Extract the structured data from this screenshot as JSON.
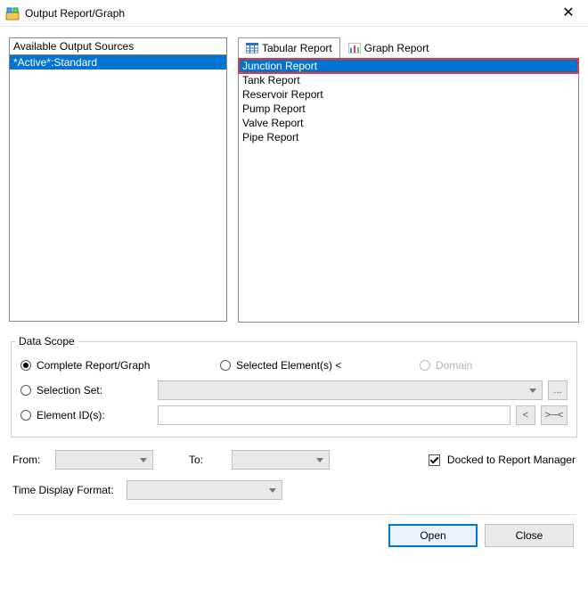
{
  "window": {
    "title": "Output Report/Graph"
  },
  "sources": {
    "header": "Available Output Sources",
    "items": [
      "*Active*:Standard"
    ]
  },
  "tabs": {
    "tabular": "Tabular Report",
    "graph": "Graph Report"
  },
  "reports": {
    "items": [
      "Junction Report",
      "Tank Report",
      "Reservoir Report",
      "Pump Report",
      "Valve Report",
      "Pipe Report"
    ],
    "selected_index": 0
  },
  "data_scope": {
    "legend": "Data Scope",
    "complete": "Complete Report/Graph",
    "selected_elements": "Selected Element(s) <",
    "domain": "Domain",
    "selection_set": "Selection Set:",
    "element_ids": "Element ID(s):",
    "ellipsis": "...",
    "prev": "<",
    "next": ">─<"
  },
  "time": {
    "from": "From:",
    "to": "To:",
    "docked": "Docked to Report Manager",
    "format_label": "Time Display Format:"
  },
  "buttons": {
    "open": "Open",
    "close": "Close"
  }
}
